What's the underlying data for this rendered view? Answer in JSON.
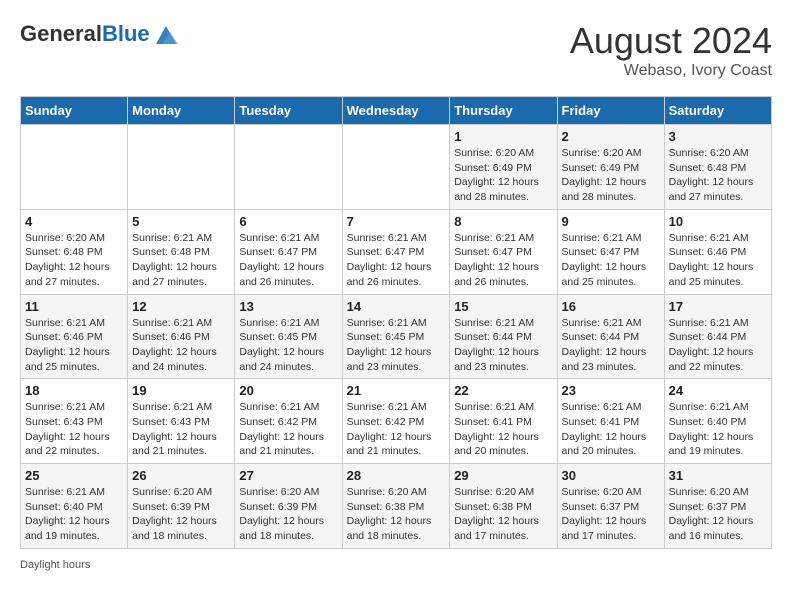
{
  "header": {
    "logo_general": "General",
    "logo_blue": "Blue",
    "month_title": "August 2024",
    "subtitle": "Webaso, Ivory Coast"
  },
  "days_of_week": [
    "Sunday",
    "Monday",
    "Tuesday",
    "Wednesday",
    "Thursday",
    "Friday",
    "Saturday"
  ],
  "footer": {
    "daylight_hours": "Daylight hours"
  },
  "weeks": [
    [
      {
        "day": "",
        "info": ""
      },
      {
        "day": "",
        "info": ""
      },
      {
        "day": "",
        "info": ""
      },
      {
        "day": "",
        "info": ""
      },
      {
        "day": "1",
        "info": "Sunrise: 6:20 AM\nSunset: 6:49 PM\nDaylight: 12 hours\nand 28 minutes."
      },
      {
        "day": "2",
        "info": "Sunrise: 6:20 AM\nSunset: 6:49 PM\nDaylight: 12 hours\nand 28 minutes."
      },
      {
        "day": "3",
        "info": "Sunrise: 6:20 AM\nSunset: 6:48 PM\nDaylight: 12 hours\nand 27 minutes."
      }
    ],
    [
      {
        "day": "4",
        "info": "Sunrise: 6:20 AM\nSunset: 6:48 PM\nDaylight: 12 hours\nand 27 minutes."
      },
      {
        "day": "5",
        "info": "Sunrise: 6:21 AM\nSunset: 6:48 PM\nDaylight: 12 hours\nand 27 minutes."
      },
      {
        "day": "6",
        "info": "Sunrise: 6:21 AM\nSunset: 6:47 PM\nDaylight: 12 hours\nand 26 minutes."
      },
      {
        "day": "7",
        "info": "Sunrise: 6:21 AM\nSunset: 6:47 PM\nDaylight: 12 hours\nand 26 minutes."
      },
      {
        "day": "8",
        "info": "Sunrise: 6:21 AM\nSunset: 6:47 PM\nDaylight: 12 hours\nand 26 minutes."
      },
      {
        "day": "9",
        "info": "Sunrise: 6:21 AM\nSunset: 6:47 PM\nDaylight: 12 hours\nand 25 minutes."
      },
      {
        "day": "10",
        "info": "Sunrise: 6:21 AM\nSunset: 6:46 PM\nDaylight: 12 hours\nand 25 minutes."
      }
    ],
    [
      {
        "day": "11",
        "info": "Sunrise: 6:21 AM\nSunset: 6:46 PM\nDaylight: 12 hours\nand 25 minutes."
      },
      {
        "day": "12",
        "info": "Sunrise: 6:21 AM\nSunset: 6:46 PM\nDaylight: 12 hours\nand 24 minutes."
      },
      {
        "day": "13",
        "info": "Sunrise: 6:21 AM\nSunset: 6:45 PM\nDaylight: 12 hours\nand 24 minutes."
      },
      {
        "day": "14",
        "info": "Sunrise: 6:21 AM\nSunset: 6:45 PM\nDaylight: 12 hours\nand 23 minutes."
      },
      {
        "day": "15",
        "info": "Sunrise: 6:21 AM\nSunset: 6:44 PM\nDaylight: 12 hours\nand 23 minutes."
      },
      {
        "day": "16",
        "info": "Sunrise: 6:21 AM\nSunset: 6:44 PM\nDaylight: 12 hours\nand 23 minutes."
      },
      {
        "day": "17",
        "info": "Sunrise: 6:21 AM\nSunset: 6:44 PM\nDaylight: 12 hours\nand 22 minutes."
      }
    ],
    [
      {
        "day": "18",
        "info": "Sunrise: 6:21 AM\nSunset: 6:43 PM\nDaylight: 12 hours\nand 22 minutes."
      },
      {
        "day": "19",
        "info": "Sunrise: 6:21 AM\nSunset: 6:43 PM\nDaylight: 12 hours\nand 21 minutes."
      },
      {
        "day": "20",
        "info": "Sunrise: 6:21 AM\nSunset: 6:42 PM\nDaylight: 12 hours\nand 21 minutes."
      },
      {
        "day": "21",
        "info": "Sunrise: 6:21 AM\nSunset: 6:42 PM\nDaylight: 12 hours\nand 21 minutes."
      },
      {
        "day": "22",
        "info": "Sunrise: 6:21 AM\nSunset: 6:41 PM\nDaylight: 12 hours\nand 20 minutes."
      },
      {
        "day": "23",
        "info": "Sunrise: 6:21 AM\nSunset: 6:41 PM\nDaylight: 12 hours\nand 20 minutes."
      },
      {
        "day": "24",
        "info": "Sunrise: 6:21 AM\nSunset: 6:40 PM\nDaylight: 12 hours\nand 19 minutes."
      }
    ],
    [
      {
        "day": "25",
        "info": "Sunrise: 6:21 AM\nSunset: 6:40 PM\nDaylight: 12 hours\nand 19 minutes."
      },
      {
        "day": "26",
        "info": "Sunrise: 6:20 AM\nSunset: 6:39 PM\nDaylight: 12 hours\nand 18 minutes."
      },
      {
        "day": "27",
        "info": "Sunrise: 6:20 AM\nSunset: 6:39 PM\nDaylight: 12 hours\nand 18 minutes."
      },
      {
        "day": "28",
        "info": "Sunrise: 6:20 AM\nSunset: 6:38 PM\nDaylight: 12 hours\nand 18 minutes."
      },
      {
        "day": "29",
        "info": "Sunrise: 6:20 AM\nSunset: 6:38 PM\nDaylight: 12 hours\nand 17 minutes."
      },
      {
        "day": "30",
        "info": "Sunrise: 6:20 AM\nSunset: 6:37 PM\nDaylight: 12 hours\nand 17 minutes."
      },
      {
        "day": "31",
        "info": "Sunrise: 6:20 AM\nSunset: 6:37 PM\nDaylight: 12 hours\nand 16 minutes."
      }
    ]
  ]
}
